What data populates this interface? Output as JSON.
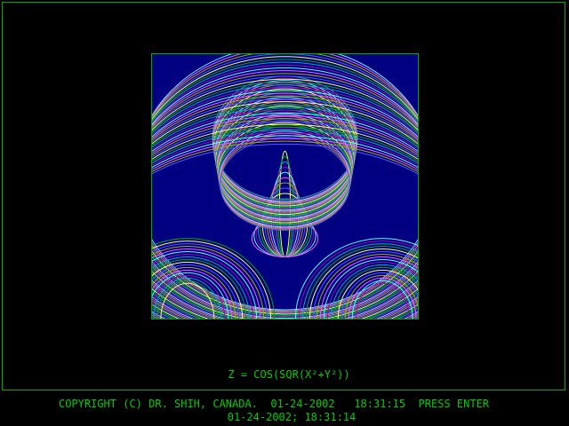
{
  "screen": {
    "formula": "Z = COS(SQR(X²+Y²))",
    "status_line": "COPYRIGHT (C) DR. SHIH, CANADA.  01-24-2002   18:31:15  PRESS ENTER",
    "timestamp_line": "01-24-2002; 18:31:14"
  },
  "colors": {
    "background": "#000000",
    "border": "#00aa00",
    "text": "#00cc00",
    "plot_background": "#000080",
    "palette": [
      "#ffff55",
      "#00aa00",
      "#00aaaa",
      "#aa00aa",
      "#55ffff",
      "#ff55ff",
      "#aaaa00",
      "#5555ff"
    ]
  },
  "plot": {
    "function": "cos(sqrt(x^2+y^2))",
    "style": "wireframe surface"
  }
}
